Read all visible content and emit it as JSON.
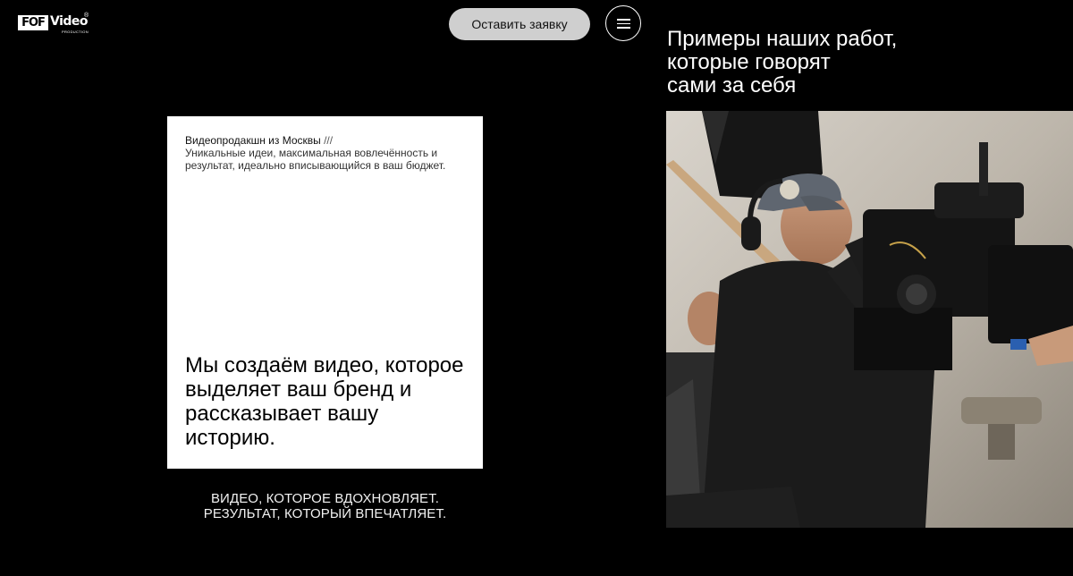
{
  "header": {
    "logo_text": "FOF",
    "logo_word": "Video",
    "logo_sub": "PRODUCTION",
    "logo_reg": "®",
    "cta_label": "Оставить заявку",
    "menu_icon": "hamburger-icon"
  },
  "hero": {
    "kicker_title": "Видеопродакшн из Москвы",
    "kicker_slashes": " ///",
    "kicker_desc": "Уникальные идеи, максимальная вовлечённость и результат, идеально вписывающийся в ваш бюджет.",
    "headline": "Мы создаём видео, которое выделяет ваш бренд и рассказывает вашу историю.",
    "tagline_line1": "ВИДЕО, КОТОРОЕ ВДОХНОВЛЯЕТ.",
    "tagline_line2": "РЕЗУЛЬТАТ, КОТОРЫЙ ВПЕЧАТЛЯЕТ."
  },
  "works": {
    "title_line1": "Примеры наших работ,",
    "title_line2": "которые говорят",
    "title_line3": "сами за себя"
  },
  "colors": {
    "background": "#000000",
    "card": "#ffffff",
    "cta_bg": "#cfcfcf"
  }
}
